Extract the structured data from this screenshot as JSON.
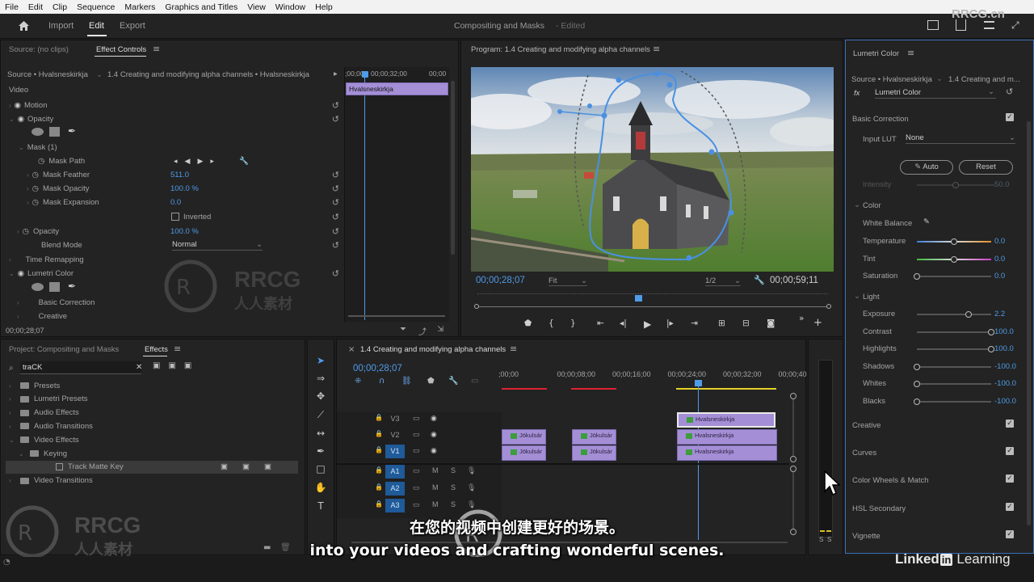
{
  "menu": [
    "File",
    "Edit",
    "Clip",
    "Sequence",
    "Markers",
    "Graphics and Titles",
    "View",
    "Window",
    "Help"
  ],
  "topbar": {
    "import": "Import",
    "edit": "Edit",
    "export": "Export",
    "project_title": "Compositing and Masks",
    "edited": "- Edited",
    "watermark": "RRCG.cn"
  },
  "source_panel": {
    "label": "Source: (no clips)",
    "tab": "Effect Controls"
  },
  "effect_controls": {
    "source": "Source • Hvalsneskirkja",
    "sequence": "1.4 Creating and modifying alpha channels • Hvalsneskirkja",
    "time_a": ";00;00",
    "time_b": "00;00;32;00",
    "time_c": "00;00",
    "clip_name": "Hvalsneskirkja",
    "video": "Video",
    "motion": "Motion",
    "opacity": "Opacity",
    "mask": "Mask (1)",
    "mask_path": "Mask Path",
    "mask_feather": "Mask Feather",
    "mask_feather_val": "511.0",
    "mask_opacity": "Mask Opacity",
    "mask_opacity_val": "100.0 %",
    "mask_expansion": "Mask Expansion",
    "mask_expansion_val": "0.0",
    "inverted": "Inverted",
    "opacity2": "Opacity",
    "opacity2_val": "100.0 %",
    "blend_mode": "Blend Mode",
    "blend_val": "Normal",
    "time_remap": "Time Remapping",
    "lumetri": "Lumetri Color",
    "basic_correction": "Basic Correction",
    "creative": "Creative",
    "current_time": "00;00;28;07"
  },
  "program": {
    "title": "Program: 1.4 Creating and modifying alpha channels",
    "timecode": "00;00;28;07",
    "fit": "Fit",
    "resolution": "1/2",
    "duration": "00;00;59;11",
    "playhead_fraction": 0.46
  },
  "lumetri": {
    "title": "Lumetri Color",
    "source": "Source • Hvalsneskirkja",
    "sequence": "1.4 Creating and m...",
    "fx": "fx",
    "effect": "Lumetri Color",
    "basic": "Basic Correction",
    "input_lut": "Input LUT",
    "lut_val": "None",
    "auto": "Auto",
    "reset": "Reset",
    "intensity": "Intensity",
    "intensity_val": "50.0",
    "color": "Color",
    "white_balance": "White Balance",
    "rows": [
      {
        "name": "Temperature",
        "val": "0.0",
        "pos": 0.5
      },
      {
        "name": "Tint",
        "val": "0.0",
        "pos": 0.5
      },
      {
        "name": "Saturation",
        "val": "0.0",
        "pos": 0.0
      }
    ],
    "light": "Light",
    "light_rows": [
      {
        "name": "Exposure",
        "val": "2.2",
        "pos": 0.7
      },
      {
        "name": "Contrast",
        "val": "100.0",
        "pos": 1.0
      },
      {
        "name": "Highlights",
        "val": "100.0",
        "pos": 1.0
      },
      {
        "name": "Shadows",
        "val": "-100.0",
        "pos": 0.0
      },
      {
        "name": "Whites",
        "val": "-100.0",
        "pos": 0.0
      },
      {
        "name": "Blacks",
        "val": "-100.0",
        "pos": 0.0
      }
    ],
    "sections": [
      "Creative",
      "Curves",
      "Color Wheels & Match",
      "HSL Secondary",
      "Vignette"
    ]
  },
  "project": {
    "label": "Project: Compositing and Masks",
    "tab": "Effects",
    "search": "traCK",
    "items": [
      {
        "name": "Presets",
        "level": 0
      },
      {
        "name": "Lumetri Presets",
        "level": 0
      },
      {
        "name": "Audio Effects",
        "level": 0
      },
      {
        "name": "Audio Transitions",
        "level": 0
      },
      {
        "name": "Video Effects",
        "level": 0
      },
      {
        "name": "Keying",
        "level": 1
      },
      {
        "name": "Track Matte Key",
        "level": 2
      },
      {
        "name": "Video Transitions",
        "level": 0
      }
    ]
  },
  "timeline": {
    "title": "1.4 Creating and modifying alpha channels",
    "timecode": "00;00;28;07",
    "ruler": [
      ";00;00",
      "00;00;08;00",
      "00;00;16;00",
      "00;00;24;00",
      "00;00;32;00",
      "00;00;40"
    ],
    "tracks": [
      "V3",
      "V2",
      "V1",
      "A1",
      "A2",
      "A3"
    ],
    "mute": "M",
    "solo": "S",
    "clips": {
      "jokulsar": "Jökulsár",
      "hval": "Hvalsneskirkja"
    },
    "meter_labels": [
      "S",
      "S"
    ]
  },
  "subtitles": {
    "zh": "在您的视频中创建更好的场景。",
    "en": "into your videos and crafting wonderful scenes."
  },
  "branding": {
    "linkedin": "Linked",
    "in": "in",
    "learning": "Learning",
    "rrcg": "RRCG",
    "rrcg_cn": "人人素材"
  }
}
